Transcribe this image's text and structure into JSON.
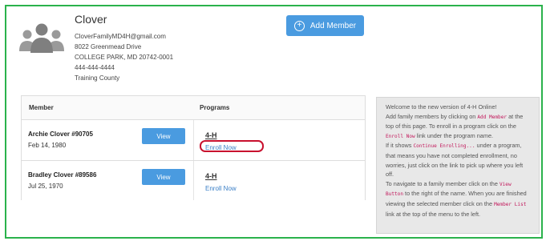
{
  "family": {
    "name": "Clover",
    "email": "CloverFamilyMD4H@gmail.com",
    "address_line1": "8022 Greenmead Drive",
    "address_line2": "COLLEGE PARK, MD 20742-0001",
    "phone": "444-444-4444",
    "county": "Training County"
  },
  "actions": {
    "add_member_label": "Add Member"
  },
  "table": {
    "col_member": "Member",
    "col_programs": "Programs",
    "view_label": "View",
    "rows": [
      {
        "name": "Archie Clover #90705",
        "date": "Feb 14, 1980",
        "program": "4-H",
        "enroll": "Enroll Now",
        "highlighted": true
      },
      {
        "name": "Bradley Clover #89586",
        "date": "Jul 25, 1970",
        "program": "4-H",
        "enroll": "Enroll Now",
        "highlighted": false
      }
    ]
  },
  "info": {
    "l1": "Welcome to the new version of 4-H Online!",
    "l2a": "Add family members by clicking on ",
    "c_add": "Add Member",
    "l2b": " at the top of this page. To enroll in a program click on the ",
    "c_enroll": "Enroll Now",
    "l2c": " link under the program name.",
    "l3a": "If it shows ",
    "c_continue": "Continue Enrolling...",
    "l3b": " under a program, that means you have not completed enrollment, no worries, just click on the link to pick up where you left off.",
    "l4a": "To navigate to a family member click on the ",
    "c_view": "View Button",
    "l4b": " to the right of the name. When you are finished viewing the selected member click on the ",
    "c_list": "Member List",
    "l4c": " link at the top of the menu to the left."
  },
  "colors": {
    "frame_green": "#2bb24c",
    "button_blue": "#4a9be0",
    "link_blue": "#3a7fc7",
    "highlight_red": "#c8102e",
    "code_pink": "#c2185b"
  }
}
